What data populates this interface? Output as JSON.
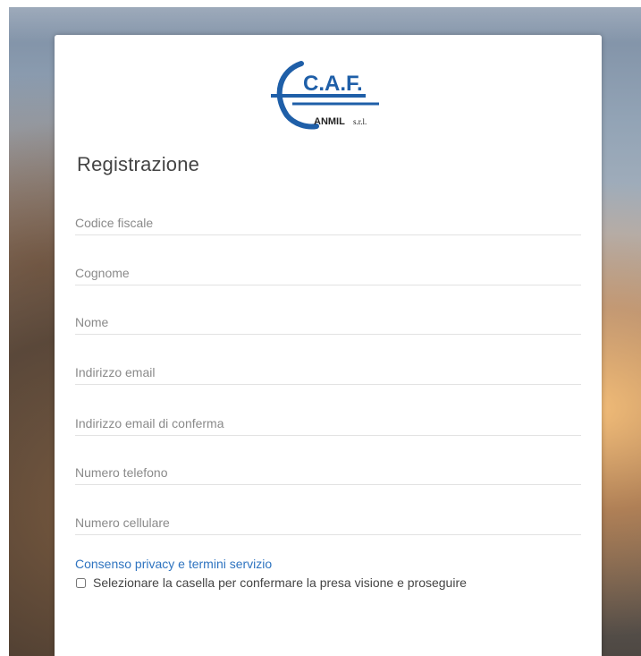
{
  "logo": {
    "main_text": "C.A.F.",
    "sub_text": "ANMIL",
    "suffix_text": "s.r.l.",
    "brand_color": "#1f5fa8",
    "accent_color": "#222222"
  },
  "form": {
    "title": "Registrazione",
    "fields": [
      {
        "name": "codice-fiscale",
        "placeholder": "Codice fiscale"
      },
      {
        "name": "cognome",
        "placeholder": "Cognome"
      },
      {
        "name": "nome",
        "placeholder": "Nome"
      },
      {
        "name": "email",
        "placeholder": "Indirizzo email"
      },
      {
        "name": "email-conferma",
        "placeholder": "Indirizzo email di conferma"
      },
      {
        "name": "telefono",
        "placeholder": "Numero telefono"
      },
      {
        "name": "cellulare",
        "placeholder": "Numero cellulare"
      }
    ],
    "privacy_link": "Consenso privacy e termini servizio",
    "checkbox_label": "Selezionare la casella per confermare la presa visione e proseguire",
    "checkbox_checked": false
  },
  "colors": {
    "link": "#2f74c0",
    "title": "#444444",
    "placeholder": "#8a8a8a"
  }
}
